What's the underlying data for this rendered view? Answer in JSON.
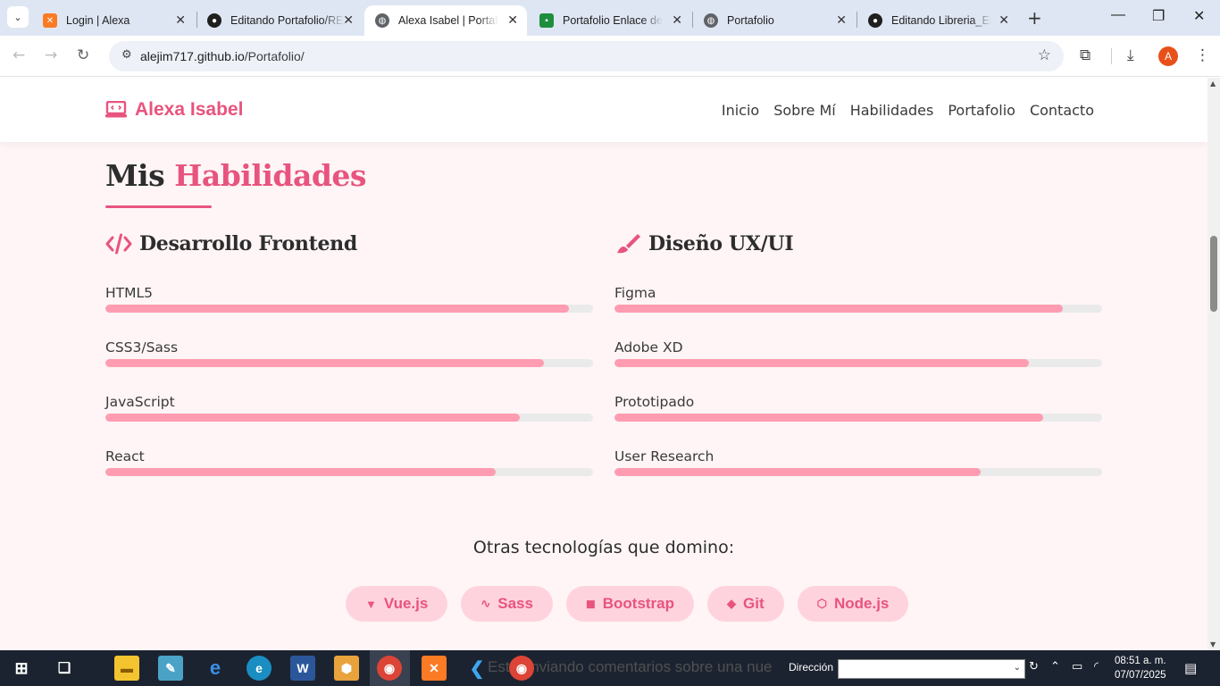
{
  "browser": {
    "tabs": [
      {
        "title": "Login | Alexa",
        "favicon": "xampp-icon",
        "active": false
      },
      {
        "title": "Editando Portafolio/README",
        "favicon": "github-icon",
        "active": false
      },
      {
        "title": "Alexa Isabel | Portafolio",
        "favicon": "globe-icon",
        "active": true
      },
      {
        "title": "Portafolio Enlace de acceso",
        "favicon": "google-classroom-icon",
        "active": false
      },
      {
        "title": "Portafolio",
        "favicon": "globe-icon",
        "active": false
      },
      {
        "title": "Editando Libreria_Esp",
        "favicon": "github-icon",
        "active": false
      }
    ],
    "url_host": "alejim717.github.io",
    "url_path": "/Portafolio/",
    "profile_initial": "A"
  },
  "site": {
    "brand": "Alexa Isabel",
    "nav": [
      "Inicio",
      "Sobre Mí",
      "Habilidades",
      "Portafolio",
      "Contacto"
    ]
  },
  "skills_section": {
    "title_part1": "Mis",
    "title_part2": "Habilidades",
    "columns": [
      {
        "heading": "Desarrollo Frontend",
        "icon": "code-icon",
        "skills": [
          {
            "name": "HTML5",
            "level": 0.95
          },
          {
            "name": "CSS3/Sass",
            "level": 0.9
          },
          {
            "name": "JavaScript",
            "level": 0.85
          },
          {
            "name": "React",
            "level": 0.8
          }
        ]
      },
      {
        "heading": "Diseño UX/UI",
        "icon": "paintbrush-icon",
        "skills": [
          {
            "name": "Figma",
            "level": 0.92
          },
          {
            "name": "Adobe XD",
            "level": 0.85
          },
          {
            "name": "Prototipado",
            "level": 0.88
          },
          {
            "name": "User Research",
            "level": 0.75
          }
        ]
      }
    ],
    "other_title": "Otras tecnologías que domino:",
    "other_tech": [
      {
        "name": "Vue.js",
        "icon": "vue-icon"
      },
      {
        "name": "Sass",
        "icon": "sass-icon"
      },
      {
        "name": "Bootstrap",
        "icon": "bootstrap-icon"
      },
      {
        "name": "Git",
        "icon": "git-icon"
      },
      {
        "name": "Node.js",
        "icon": "nodejs-icon"
      }
    ]
  },
  "taskbar": {
    "address_label": "Dirección",
    "time": "08:51 a. m.",
    "date": "07/07/2025",
    "ghost_text": "Está enviando comentarios sobre una nue"
  },
  "colors": {
    "accent": "#e8547e",
    "bar_fill": "#ff9cb1",
    "chip_bg": "#ffd3dd",
    "page_bg": "#fff5f6"
  }
}
